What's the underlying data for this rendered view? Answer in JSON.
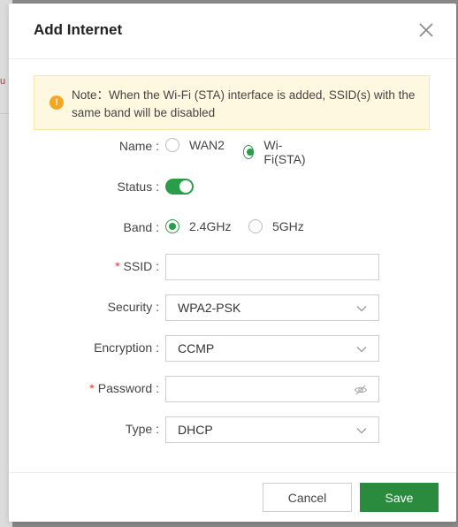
{
  "backdrop": {
    "peek_text": "u"
  },
  "modal": {
    "title": "Add Internet",
    "note": "Note：When the Wi-Fi (STA) interface is added, SSID(s) with the same band will be disabled"
  },
  "form": {
    "name": {
      "label": "Name :",
      "options": [
        "WAN2",
        "Wi-Fi(STA)"
      ],
      "selected": "Wi-Fi(STA)"
    },
    "status": {
      "label": "Status :",
      "enabled": true
    },
    "band": {
      "label": "Band :",
      "options": [
        "2.4GHz",
        "5GHz"
      ],
      "selected": "2.4GHz"
    },
    "ssid": {
      "label": "SSID :",
      "required": "*",
      "value": ""
    },
    "security": {
      "label": "Security :",
      "value": "WPA2-PSK"
    },
    "encryption": {
      "label": "Encryption :",
      "value": "CCMP"
    },
    "password": {
      "label": "Password :",
      "required": "*",
      "value": ""
    },
    "type": {
      "label": "Type :",
      "value": "DHCP"
    }
  },
  "footer": {
    "cancel_label": "Cancel",
    "save_label": "Save"
  },
  "colors": {
    "accent": "#2a9d4a",
    "save_button": "#2a8a3e",
    "note_bg": "#fff8e1",
    "note_icon": "#f5a623",
    "required": "#e53935"
  },
  "icons": {
    "close": "close-icon",
    "note": "warning-icon",
    "dropdown": "chevron-down-icon",
    "password": "eye-off-icon"
  }
}
